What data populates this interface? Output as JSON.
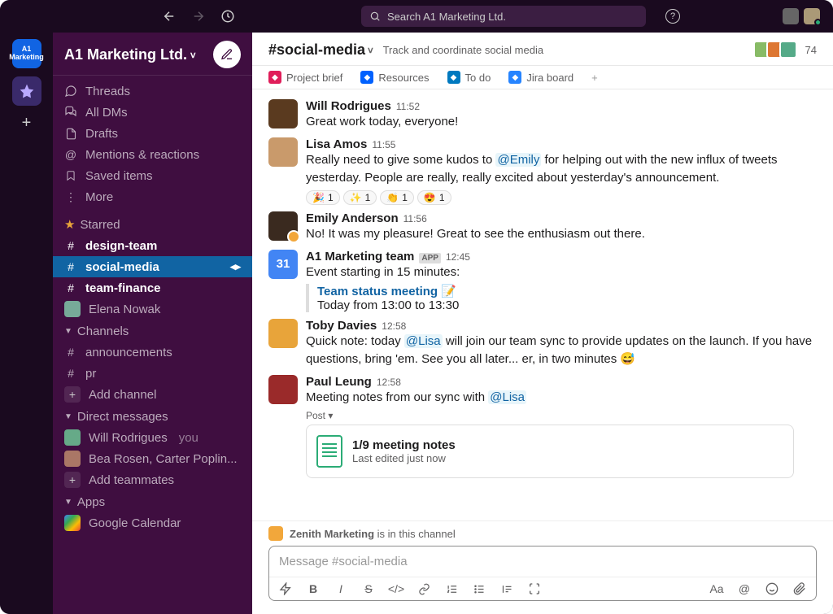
{
  "topbar": {
    "search_placeholder": "Search A1 Marketing Ltd."
  },
  "workspace": {
    "name": "A1 Marketing Ltd.",
    "icon_label": "A1 Marketing"
  },
  "sidebar": {
    "threads": "Threads",
    "all_dms": "All DMs",
    "drafts": "Drafts",
    "mentions": "Mentions & reactions",
    "saved": "Saved items",
    "more": "More",
    "starred_label": "Starred",
    "starred": [
      {
        "name": "design-team",
        "type": "channel",
        "bold": true
      },
      {
        "name": "social-media",
        "type": "channel",
        "bold": true,
        "active": true
      },
      {
        "name": "team-finance",
        "type": "channel",
        "bold": true
      },
      {
        "name": "Elena Nowak",
        "type": "dm"
      }
    ],
    "channels_label": "Channels",
    "channels": [
      {
        "name": "announcements"
      },
      {
        "name": "pr"
      }
    ],
    "add_channel": "Add channel",
    "dms_label": "Direct messages",
    "dms": [
      {
        "name": "Will Rodrigues",
        "suffix": "you"
      },
      {
        "name": "Bea Rosen, Carter Poplin..."
      }
    ],
    "add_teammates": "Add teammates",
    "apps_label": "Apps",
    "apps": [
      {
        "name": "Google Calendar"
      }
    ]
  },
  "channel": {
    "name": "#social-media",
    "topic": "Track and coordinate social media",
    "member_count": "74",
    "pins": [
      {
        "label": "Project brief",
        "color": "#e01e5a"
      },
      {
        "label": "Resources",
        "color": "#0061fe"
      },
      {
        "label": "To do",
        "color": "#0079bf"
      },
      {
        "label": "Jira board",
        "color": "#2684ff"
      }
    ]
  },
  "messages": [
    {
      "author": "Will Rodrigues",
      "time": "11:52",
      "avatar_color": "#5a3a1f",
      "text": "Great work today, everyone!"
    },
    {
      "author": "Lisa Amos",
      "time": "11:55",
      "avatar_color": "#c99a6b",
      "html": "Really need to give some kudos to <span class='mention'>@Emily</span> for helping out with the new influx of tweets yesterday. People are really, really excited about yesterday's announcement.",
      "reactions": [
        {
          "emoji": "🎉",
          "count": "1"
        },
        {
          "emoji": "✨",
          "count": "1"
        },
        {
          "emoji": "👏",
          "count": "1"
        },
        {
          "emoji": "😍",
          "count": "1"
        }
      ]
    },
    {
      "author": "Emily Anderson",
      "time": "11:56",
      "avatar_color": "#3a2a1f",
      "badge_color": "#f2a73b",
      "text": "No! It was my pleasure! Great to see the enthusiasm out there."
    },
    {
      "author": "A1 Marketing team",
      "time": "12:45",
      "is_app": true,
      "app_badge": "APP",
      "avatar_color": "#4285f4",
      "avatar_text": "31",
      "text": "Event starting in 15 minutes:",
      "event": {
        "title": "Team status meeting",
        "emoji": "📝",
        "detail": "Today from 13:00 to 13:30"
      }
    },
    {
      "author": "Toby Davies",
      "time": "12:58",
      "avatar_color": "#e8a43a",
      "html": "Quick note: today <span class='mention'>@Lisa</span> will join our team sync to provide updates on the launch. If you have questions, bring 'em. See you all later... er, in two minutes 😅"
    },
    {
      "author": "Paul Leung",
      "time": "12:58",
      "avatar_color": "#9a2a2a",
      "html": "Meeting notes from our sync with <span class='mention'>@Lisa</span>",
      "post_label": "Post ▾",
      "attachment": {
        "title": "1/9 meeting notes",
        "subtitle": "Last edited just now"
      }
    }
  ],
  "channel_notice": {
    "org": "Zenith Marketing",
    "suffix": "is in this channel"
  },
  "composer": {
    "placeholder": "Message #social-media"
  }
}
